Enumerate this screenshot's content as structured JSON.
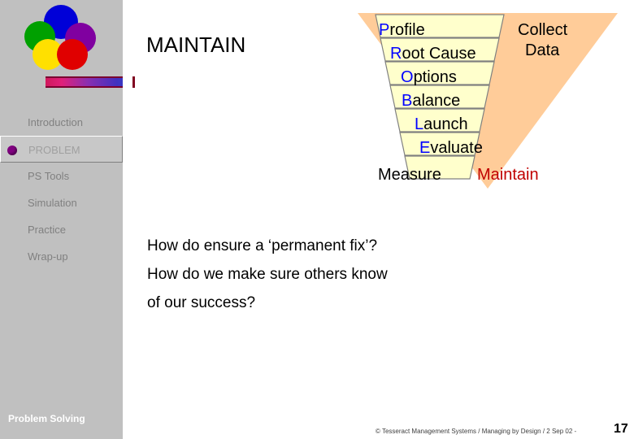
{
  "slide": {
    "title": "MAINTAIN",
    "sidebar": {
      "footer_label": "Problem Solving",
      "items": [
        {
          "label": "Introduction",
          "active": false
        },
        {
          "label": "PROBLEM",
          "active": true
        },
        {
          "label": "PS Tools",
          "active": false
        },
        {
          "label": "Simulation",
          "active": false
        },
        {
          "label": "Practice",
          "active": false
        },
        {
          "label": "Wrap-up",
          "active": false
        }
      ]
    },
    "funnel": {
      "steps": [
        {
          "initial": "P",
          "rest": "rofile"
        },
        {
          "initial": "R",
          "rest": "oot Cause"
        },
        {
          "initial": "O",
          "rest": "ptions"
        },
        {
          "initial": "B",
          "rest": "alance"
        },
        {
          "initial": "L",
          "rest": "aunch"
        },
        {
          "initial": "E",
          "rest": "valuate"
        }
      ],
      "measure_label": "Measure",
      "maintain_label": "Maintain",
      "collect_label": "Collect",
      "data_label": "Data",
      "colors": {
        "triangle": "#ffcc99",
        "band": "#ffffcc",
        "band_outline": "#808080",
        "highlight_initial": "#0000ff",
        "maintain_text": "#c00000"
      }
    },
    "body": {
      "line1": "How do ensure a ‘permanent fix’?",
      "line2": "How do we make sure others know",
      "line3": "of our success?"
    },
    "footer": {
      "credit": "© Tesseract Management Systems / Managing by Design / 2 Sep 02  -",
      "page_number": "17"
    }
  }
}
